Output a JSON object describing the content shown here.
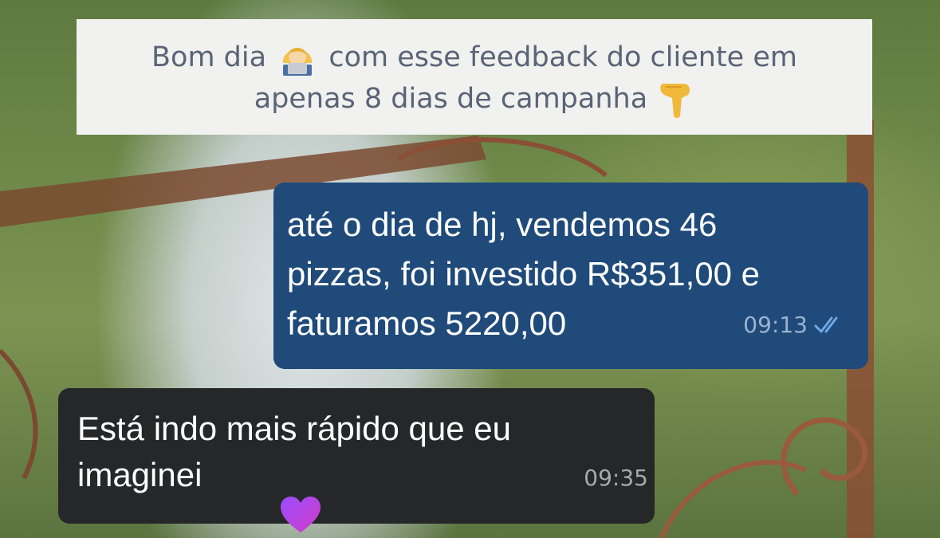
{
  "caption": {
    "line1_before": "Bom dia",
    "line1_after": "com esse feedback do cliente em",
    "line2": "apenas 8 dias de campanha",
    "emoji1": "woman-technologist-emoji",
    "emoji2": "pointing-down-emoji"
  },
  "messages": [
    {
      "direction": "outgoing",
      "text": "até o dia de hj, vendemos 46\npizzas, foi investido R$351,00 e\nfaturamos 5220,00",
      "time": "09:13",
      "status_icon": "double-check-read-icon"
    },
    {
      "direction": "incoming",
      "text": "Está indo mais rápido que eu\nimaginei",
      "time": "09:35",
      "reaction": "purple-heart-emoji"
    }
  ],
  "colors": {
    "outgoing_bubble": "#1f4a7a",
    "incoming_bubble": "#262728",
    "caption_bg": "#f1f1ef",
    "caption_text": "#5a6477",
    "read_check": "#6fa8e8"
  }
}
